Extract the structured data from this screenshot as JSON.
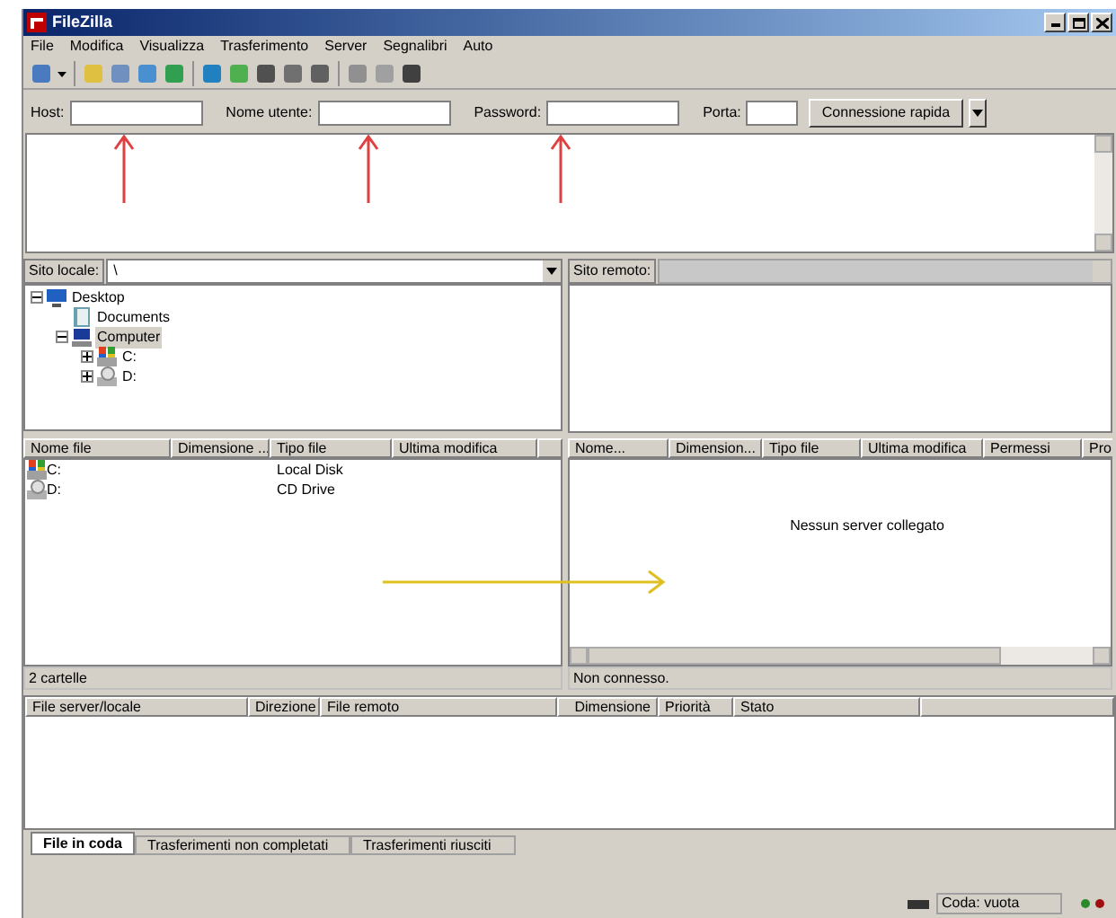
{
  "window": {
    "title": "FileZilla"
  },
  "menu": [
    "File",
    "Modifica",
    "Visualizza",
    "Trasferimento",
    "Server",
    "Segnalibri",
    "Auto"
  ],
  "quickconnect": {
    "fields": [
      {
        "label": "Host:",
        "kind": "wide"
      },
      {
        "label": "Nome utente:",
        "kind": "wide"
      },
      {
        "label": "Password:",
        "kind": "wide"
      },
      {
        "label": "Porta:",
        "kind": "narrow"
      }
    ],
    "button": "Connessione rapida"
  },
  "local": {
    "label": "Sito locale:",
    "path": "\\",
    "tree": [
      {
        "name": "Desktop",
        "kind": "desktop",
        "expanded": true,
        "selected": false,
        "children": [
          {
            "name": "Documents",
            "kind": "docs",
            "selected": false
          },
          {
            "name": "Computer",
            "kind": "computer",
            "expanded": true,
            "selected": true,
            "children": [
              {
                "name": "C:",
                "kind": "disk",
                "expanded": false,
                "selected": false
              },
              {
                "name": "D:",
                "kind": "cd",
                "expanded": false,
                "selected": false
              }
            ]
          }
        ]
      }
    ],
    "columns": [
      "Nome file",
      "Dimensione ...",
      "Tipo file",
      "Ultima modifica"
    ],
    "rows": [
      {
        "name": "C:",
        "kind": "disk",
        "type": "Local Disk"
      },
      {
        "name": "D:",
        "kind": "cd",
        "type": "CD Drive"
      }
    ],
    "status": "2 cartelle"
  },
  "remote": {
    "label": "Sito remoto:",
    "columns": [
      "Nome...",
      "Dimension...",
      "Tipo file",
      "Ultima modifica",
      "Permessi",
      "Pro"
    ],
    "message": "Nessun server collegato",
    "status": "Non connesso."
  },
  "queue": {
    "columns": [
      "File server/locale",
      "Direzione",
      "File remoto",
      "Dimensione",
      "Priorità",
      "Stato"
    ],
    "tabs": [
      {
        "label": "File in coda",
        "selected": true
      },
      {
        "label": "Trasferimenti non completati",
        "selected": false
      },
      {
        "label": "Trasferimenti riusciti",
        "selected": false
      }
    ]
  },
  "status_bar": {
    "queue": "Coda: vuota"
  }
}
